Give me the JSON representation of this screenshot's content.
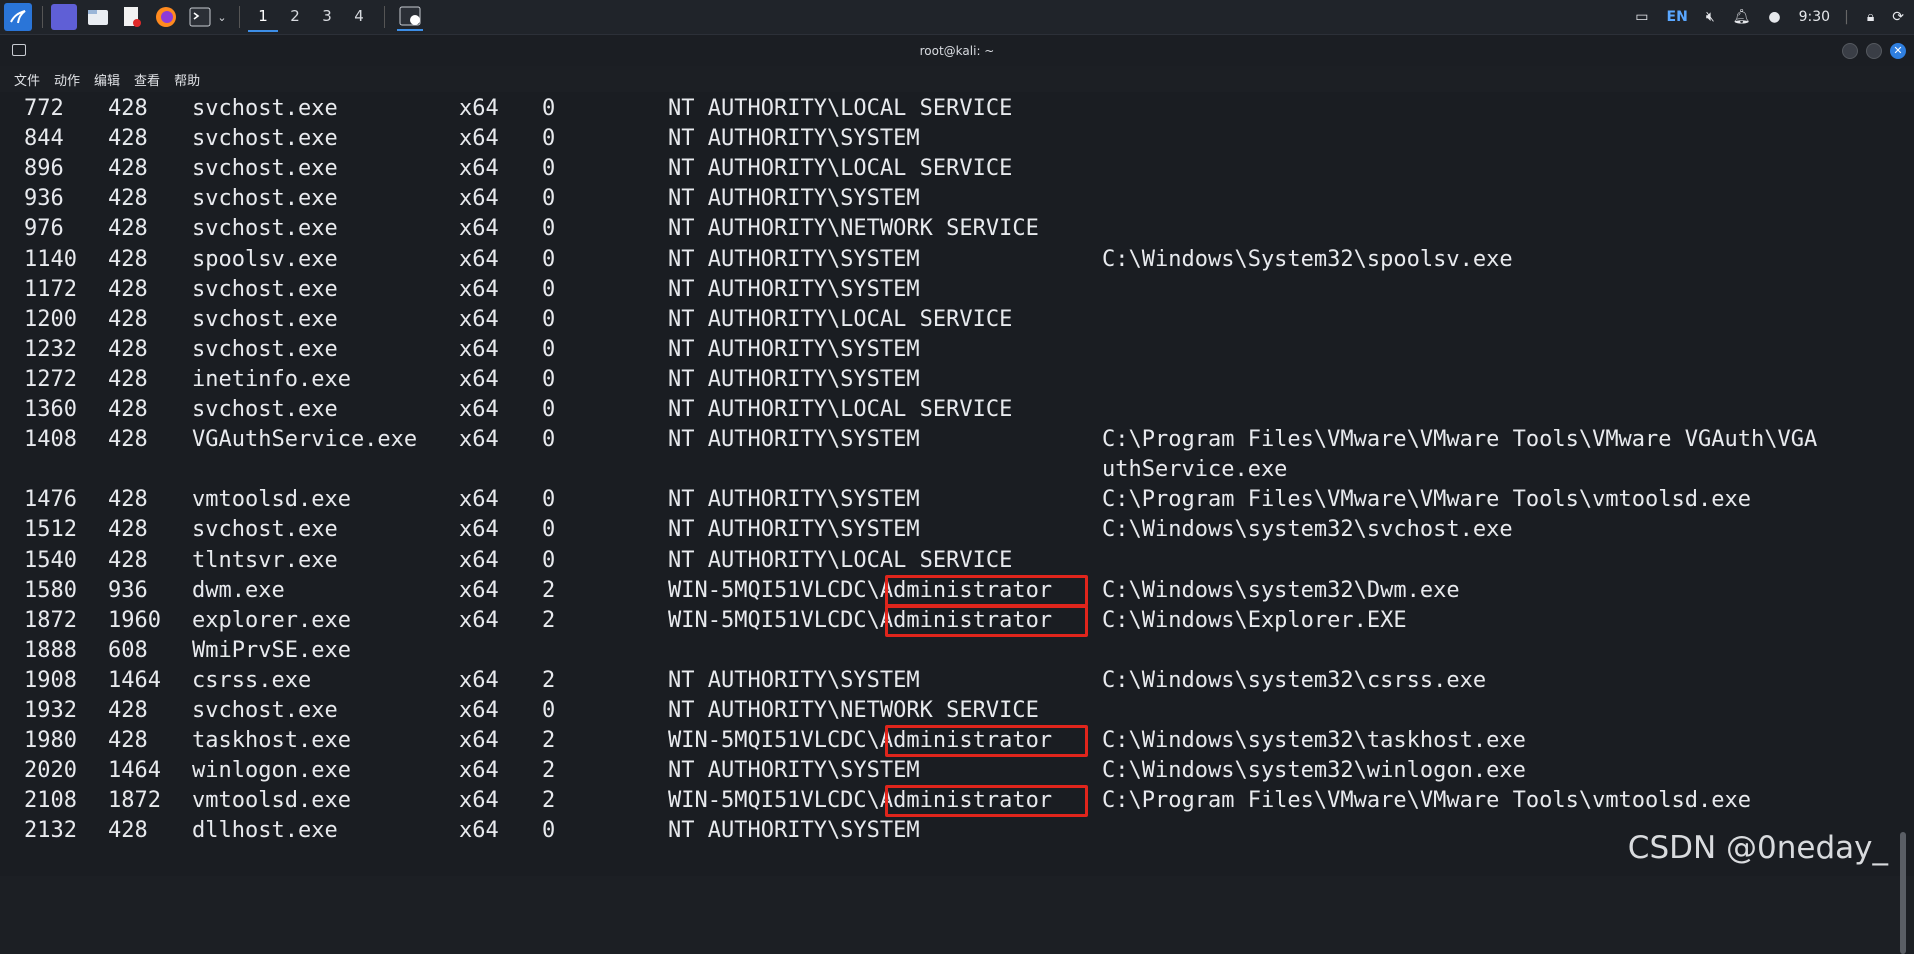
{
  "taskbar": {
    "launchers": [
      "kali-menu-icon",
      "desktop-icon",
      "files-icon",
      "text-editor-icon",
      "firefox-icon",
      "terminal-icon"
    ],
    "workspaces": [
      "1",
      "2",
      "3",
      "4"
    ],
    "active_workspace": "1",
    "tray": {
      "keyboard_layout": "EN",
      "time": "9:30"
    }
  },
  "window": {
    "title": "root@kali: ~"
  },
  "menu": [
    "文件",
    "动作",
    "编辑",
    "查看",
    "帮助"
  ],
  "processes": [
    {
      "pid": "772",
      "ppid": "428",
      "name": "svchost.exe",
      "arch": "x64",
      "session": "0",
      "user": "NT AUTHORITY\\LOCAL SERVICE",
      "path": ""
    },
    {
      "pid": "844",
      "ppid": "428",
      "name": "svchost.exe",
      "arch": "x64",
      "session": "0",
      "user": "NT AUTHORITY\\SYSTEM",
      "path": ""
    },
    {
      "pid": "896",
      "ppid": "428",
      "name": "svchost.exe",
      "arch": "x64",
      "session": "0",
      "user": "NT AUTHORITY\\LOCAL SERVICE",
      "path": ""
    },
    {
      "pid": "936",
      "ppid": "428",
      "name": "svchost.exe",
      "arch": "x64",
      "session": "0",
      "user": "NT AUTHORITY\\SYSTEM",
      "path": ""
    },
    {
      "pid": "976",
      "ppid": "428",
      "name": "svchost.exe",
      "arch": "x64",
      "session": "0",
      "user": "NT AUTHORITY\\NETWORK SERVICE",
      "path": ""
    },
    {
      "pid": "1140",
      "ppid": "428",
      "name": "spoolsv.exe",
      "arch": "x64",
      "session": "0",
      "user": "NT AUTHORITY\\SYSTEM",
      "path": "C:\\Windows\\System32\\spoolsv.exe"
    },
    {
      "pid": "1172",
      "ppid": "428",
      "name": "svchost.exe",
      "arch": "x64",
      "session": "0",
      "user": "NT AUTHORITY\\SYSTEM",
      "path": ""
    },
    {
      "pid": "1200",
      "ppid": "428",
      "name": "svchost.exe",
      "arch": "x64",
      "session": "0",
      "user": "NT AUTHORITY\\LOCAL SERVICE",
      "path": ""
    },
    {
      "pid": "1232",
      "ppid": "428",
      "name": "svchost.exe",
      "arch": "x64",
      "session": "0",
      "user": "NT AUTHORITY\\SYSTEM",
      "path": ""
    },
    {
      "pid": "1272",
      "ppid": "428",
      "name": "inetinfo.exe",
      "arch": "x64",
      "session": "0",
      "user": "NT AUTHORITY\\SYSTEM",
      "path": ""
    },
    {
      "pid": "1360",
      "ppid": "428",
      "name": "svchost.exe",
      "arch": "x64",
      "session": "0",
      "user": "NT AUTHORITY\\LOCAL SERVICE",
      "path": ""
    },
    {
      "pid": "1408",
      "ppid": "428",
      "name": "VGAuthService.exe",
      "arch": "x64",
      "session": "0",
      "user": "NT AUTHORITY\\SYSTEM",
      "path": "C:\\Program Files\\VMware\\VMware Tools\\VMware VGAuth\\VGA",
      "path_cont": "uthService.exe"
    },
    {
      "pid": "1476",
      "ppid": "428",
      "name": "vmtoolsd.exe",
      "arch": "x64",
      "session": "0",
      "user": "NT AUTHORITY\\SYSTEM",
      "path": "C:\\Program Files\\VMware\\VMware Tools\\vmtoolsd.exe"
    },
    {
      "pid": "1512",
      "ppid": "428",
      "name": "svchost.exe",
      "arch": "x64",
      "session": "0",
      "user": "NT AUTHORITY\\SYSTEM",
      "path": "C:\\Windows\\system32\\svchost.exe"
    },
    {
      "pid": "1540",
      "ppid": "428",
      "name": "tlntsvr.exe",
      "arch": "x64",
      "session": "0",
      "user": "NT AUTHORITY\\LOCAL SERVICE",
      "path": ""
    },
    {
      "pid": "1580",
      "ppid": "936",
      "name": "dwm.exe",
      "arch": "x64",
      "session": "2",
      "user": "WIN-5MQI51VLCDC\\Administrator",
      "path": "C:\\Windows\\system32\\Dwm.exe",
      "highlight": true
    },
    {
      "pid": "1872",
      "ppid": "1960",
      "name": "explorer.exe",
      "arch": "x64",
      "session": "2",
      "user": "WIN-5MQI51VLCDC\\Administrator",
      "path": "C:\\Windows\\Explorer.EXE",
      "highlight": true
    },
    {
      "pid": "1888",
      "ppid": "608",
      "name": "WmiPrvSE.exe",
      "arch": "",
      "session": "",
      "user": "",
      "path": ""
    },
    {
      "pid": "1908",
      "ppid": "1464",
      "name": "csrss.exe",
      "arch": "x64",
      "session": "2",
      "user": "NT AUTHORITY\\SYSTEM",
      "path": "C:\\Windows\\system32\\csrss.exe"
    },
    {
      "pid": "1932",
      "ppid": "428",
      "name": "svchost.exe",
      "arch": "x64",
      "session": "0",
      "user": "NT AUTHORITY\\NETWORK SERVICE",
      "path": ""
    },
    {
      "pid": "1980",
      "ppid": "428",
      "name": "taskhost.exe",
      "arch": "x64",
      "session": "2",
      "user": "WIN-5MQI51VLCDC\\Administrator",
      "path": "C:\\Windows\\system32\\taskhost.exe",
      "highlight": true
    },
    {
      "pid": "2020",
      "ppid": "1464",
      "name": "winlogon.exe",
      "arch": "x64",
      "session": "2",
      "user": "NT AUTHORITY\\SYSTEM",
      "path": "C:\\Windows\\system32\\winlogon.exe"
    },
    {
      "pid": "2108",
      "ppid": "1872",
      "name": "vmtoolsd.exe",
      "arch": "x64",
      "session": "2",
      "user": "WIN-5MQI51VLCDC\\Administrator",
      "path": "C:\\Program Files\\VMware\\VMware Tools\\vmtoolsd.exe",
      "highlight": true
    },
    {
      "pid": "2132",
      "ppid": "428",
      "name": "dllhost.exe",
      "arch": "x64",
      "session": "0",
      "user": "NT AUTHORITY\\SYSTEM",
      "path": ""
    }
  ],
  "highlight_color": "#e0251c",
  "watermark": "CSDN @0neday_"
}
